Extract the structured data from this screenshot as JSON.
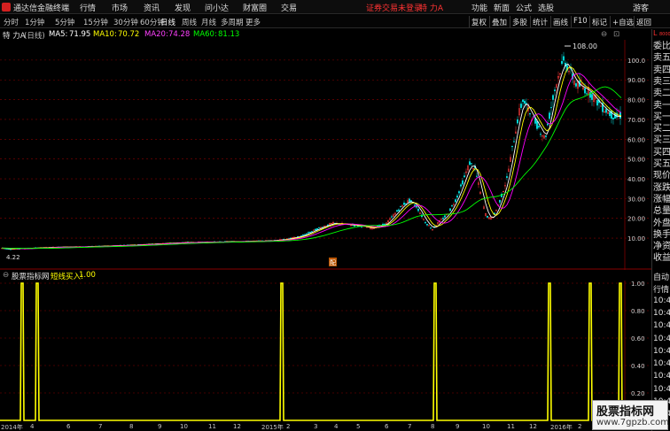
{
  "titlebar": {
    "app_title": "通达信金融终端",
    "menu": [
      "行情",
      "市场",
      "资讯",
      "发现",
      "问小达",
      "财富圈",
      "交易"
    ],
    "notice": "证券交易未登录",
    "stock_short": "特 力A",
    "right_menu": [
      "功能",
      "新面",
      "公式",
      "选股"
    ],
    "guest": "游客"
  },
  "periodbar": {
    "periods": [
      "分时",
      "1分钟",
      "5分钟",
      "15分钟",
      "30分钟",
      "60分钟",
      "日线",
      "周线",
      "月线",
      "多周期",
      "更多"
    ],
    "active": "日线",
    "tools": [
      "复权",
      "叠加",
      "多股",
      "统计",
      "画线",
      "F10",
      "标记",
      "+自选",
      "返回"
    ]
  },
  "stock": {
    "name": "特 力A",
    "period": "(日线)",
    "ma5_label": "MA5:",
    "ma5_value": "71.95",
    "ma10_label": "MA10:",
    "ma10_value": "70.72",
    "ma20_label": "MA20:",
    "ma20_value": "74.28",
    "ma60_label": "MA60:",
    "ma60_value": "81.13"
  },
  "price_axis": [
    "100.0",
    "90.00",
    "80.00",
    "70.00",
    "60.00",
    "50.00",
    "40.00",
    "30.00",
    "20.00",
    "10.00"
  ],
  "annotations": {
    "high_label": "108.00",
    "low_label": "4.22",
    "event_marker": "配"
  },
  "indicator": {
    "name": "股票指标网",
    "label": "短线买入:",
    "value": "1.00",
    "axis": [
      "1.00",
      "0.80",
      "0.60",
      "0.40",
      "0.20"
    ]
  },
  "date_axis": {
    "labels": [
      "2014年",
      "4",
      "6",
      "7",
      "8",
      "9",
      "10",
      "11",
      "12",
      "2015年",
      "2",
      "3",
      "4",
      "5",
      "6",
      "7",
      "8",
      "9",
      "10",
      "11",
      "12",
      "2016年",
      "2",
      "3"
    ]
  },
  "right_panel": {
    "top": [
      "L",
      "8000"
    ],
    "labels": [
      "委比",
      "卖五",
      "卖四",
      "卖三",
      "卖二",
      "卖一",
      "买一",
      "买二",
      "买三",
      "买四",
      "买五",
      "现价",
      "涨跌",
      "涨幅",
      "总量",
      "外盘",
      "换手",
      "净资",
      "收益"
    ],
    "lower": [
      "自动",
      "行情",
      "10:4",
      "10:4",
      "10:4",
      "10:4",
      "10:4",
      "10:4",
      "10:4",
      "10:4",
      "10:4",
      "10:4"
    ]
  },
  "watermark": {
    "title": "股票指标网",
    "url": "www.7gpzb.com"
  },
  "colors": {
    "up": "#ff3b3b",
    "down": "#00e0e0",
    "ma5": "#ffffff",
    "ma10": "#ffff00",
    "ma20": "#ff00ff",
    "ma60": "#00ff00",
    "grid": "#8a0000",
    "indicator_line": "#ffff00"
  },
  "chart_data": {
    "type": "candlestick",
    "price_series": [
      {
        "name": "MA5",
        "value": 71.95
      },
      {
        "name": "MA10",
        "value": 70.72
      },
      {
        "name": "MA20",
        "value": 74.28
      },
      {
        "name": "MA60",
        "value": 81.13
      }
    ],
    "price_path": [
      [
        0,
        5
      ],
      [
        10,
        4.5
      ],
      [
        30,
        4.8
      ],
      [
        60,
        5.4
      ],
      [
        90,
        5.6
      ],
      [
        120,
        6.0
      ],
      [
        150,
        6.5
      ],
      [
        180,
        7.2
      ],
      [
        210,
        7.8
      ],
      [
        240,
        8.0
      ],
      [
        270,
        8.3
      ],
      [
        300,
        8.6
      ],
      [
        320,
        9.2
      ],
      [
        340,
        11.0
      ],
      [
        360,
        15.0
      ],
      [
        375,
        17.5
      ],
      [
        390,
        17.0
      ],
      [
        410,
        16.0
      ],
      [
        420,
        15.0
      ],
      [
        435,
        17.0
      ],
      [
        445,
        22.0
      ],
      [
        455,
        27.0
      ],
      [
        462,
        29.0
      ],
      [
        470,
        26.0
      ],
      [
        480,
        18.0
      ],
      [
        488,
        14.5
      ],
      [
        495,
        18.0
      ],
      [
        505,
        22.0
      ],
      [
        515,
        30.0
      ],
      [
        525,
        42.0
      ],
      [
        530,
        48.0
      ],
      [
        536,
        45.0
      ],
      [
        542,
        33.0
      ],
      [
        548,
        22.0
      ],
      [
        553,
        19.5
      ],
      [
        558,
        22.0
      ],
      [
        565,
        30.0
      ],
      [
        572,
        40.0
      ],
      [
        580,
        60.0
      ],
      [
        585,
        72.0
      ],
      [
        590,
        80.0
      ],
      [
        596,
        75.0
      ],
      [
        602,
        70.0
      ],
      [
        608,
        66.0
      ],
      [
        615,
        60.0
      ],
      [
        620,
        72.0
      ],
      [
        626,
        85.0
      ],
      [
        632,
        95.0
      ],
      [
        637,
        100.0
      ],
      [
        642,
        95.0
      ],
      [
        650,
        88.0
      ],
      [
        658,
        86.0
      ],
      [
        665,
        84.0
      ],
      [
        672,
        80.0
      ],
      [
        680,
        76.0
      ],
      [
        688,
        73.0
      ],
      [
        695,
        71.0
      ],
      [
        700,
        72.0
      ]
    ],
    "ylim": [
      4.22,
      108.0
    ],
    "buy_signal_x": [
      25,
      42,
      318,
      491,
      620,
      666,
      700
    ]
  }
}
